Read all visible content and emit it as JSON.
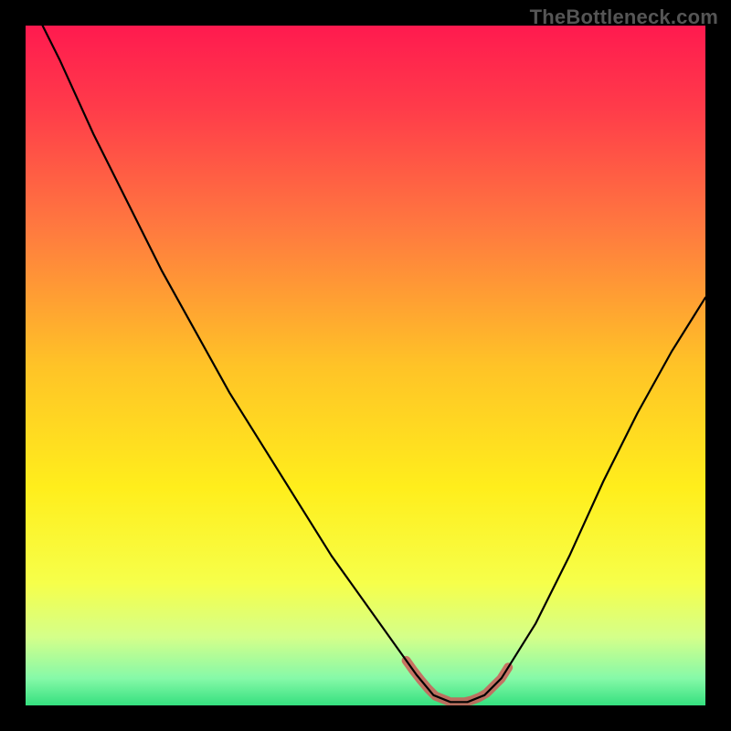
{
  "watermark": "TheBottleneck.com",
  "chart_data": {
    "type": "line",
    "title": "",
    "xlabel": "",
    "ylabel": "",
    "x": [
      0.0,
      0.05,
      0.1,
      0.15,
      0.2,
      0.25,
      0.3,
      0.35,
      0.4,
      0.45,
      0.5,
      0.55,
      0.575,
      0.6,
      0.625,
      0.65,
      0.675,
      0.7,
      0.75,
      0.8,
      0.85,
      0.9,
      0.95,
      1.0
    ],
    "values": [
      1.05,
      0.95,
      0.84,
      0.74,
      0.64,
      0.55,
      0.46,
      0.38,
      0.3,
      0.22,
      0.15,
      0.08,
      0.045,
      0.015,
      0.005,
      0.005,
      0.015,
      0.04,
      0.12,
      0.22,
      0.33,
      0.43,
      0.52,
      0.6
    ],
    "xlim": [
      0,
      1
    ],
    "ylim": [
      0,
      1
    ],
    "highlight_range_x": [
      0.56,
      0.71
    ],
    "background_gradient_stops": [
      {
        "pos": 0.0,
        "color": "#ff1a4f"
      },
      {
        "pos": 0.12,
        "color": "#ff3b4a"
      },
      {
        "pos": 0.3,
        "color": "#ff7a3f"
      },
      {
        "pos": 0.5,
        "color": "#ffc327"
      },
      {
        "pos": 0.68,
        "color": "#ffee1c"
      },
      {
        "pos": 0.82,
        "color": "#f6ff4a"
      },
      {
        "pos": 0.9,
        "color": "#d4ff8a"
      },
      {
        "pos": 0.96,
        "color": "#86f9a8"
      },
      {
        "pos": 1.0,
        "color": "#35e07f"
      }
    ]
  }
}
